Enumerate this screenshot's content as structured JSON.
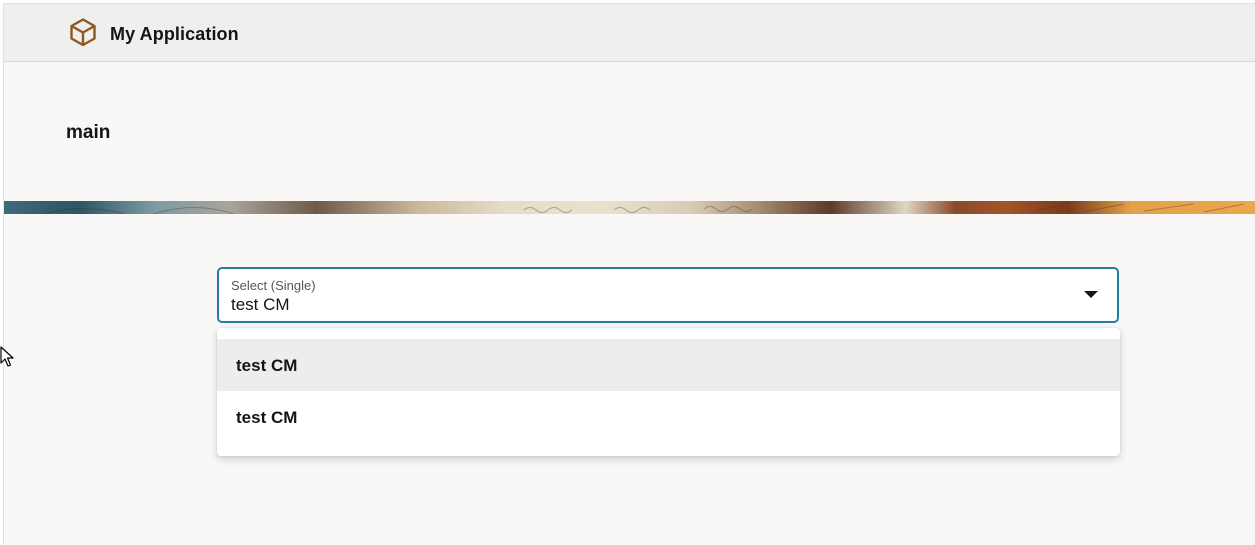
{
  "header": {
    "app_title": "My Application",
    "logo_icon": "cube-icon",
    "brand_color": "#8a5a1f"
  },
  "page": {
    "heading": "main"
  },
  "select": {
    "label": "Select (Single)",
    "value": "test CM",
    "arrow_icon": "caret-down-icon",
    "focus_color": "#227e9e"
  },
  "dropdown": {
    "options": [
      {
        "label": "test CM",
        "highlighted": true
      },
      {
        "label": "test CM",
        "highlighted": false
      }
    ]
  }
}
